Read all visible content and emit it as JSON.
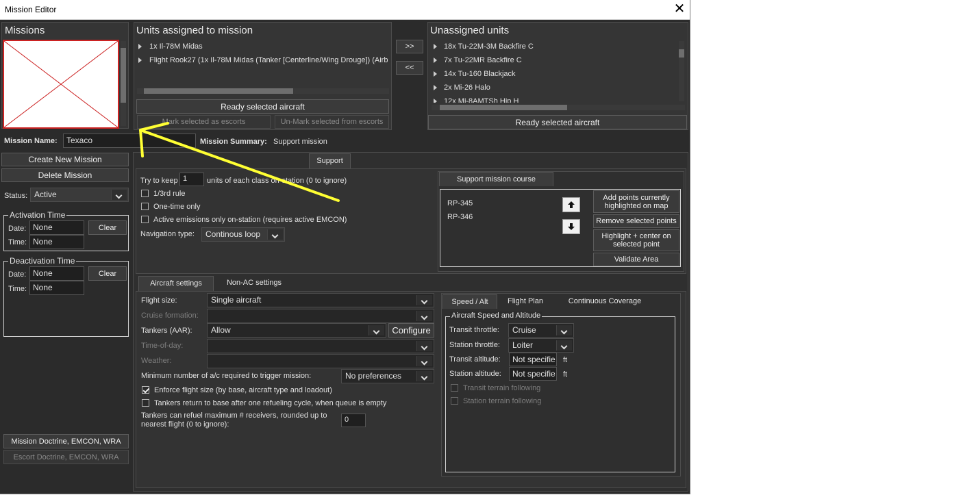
{
  "window": {
    "title": "Mission Editor",
    "close_glyph": "✕"
  },
  "missions": {
    "header": "Missions",
    "name_label": "Mission Name:",
    "name_value": "Texaco",
    "summary_label": "Mission Summary:",
    "summary_value": "Support mission",
    "create_button": "Create New Mission",
    "delete_button": "Delete Mission",
    "status_label": "Status:",
    "status_value": "Active"
  },
  "activation": {
    "title": "Activation Time",
    "date_label": "Date:",
    "date_value": "None",
    "time_label": "Time:",
    "time_value": "None",
    "clear": "Clear"
  },
  "deactivation": {
    "title": "Deactivation Time",
    "date_label": "Date:",
    "date_value": "None",
    "time_label": "Time:",
    "time_value": "None",
    "clear": "Clear"
  },
  "doctrine": {
    "mission_button": "Mission Doctrine, EMCON, WRA",
    "escort_button": "Escort Doctrine, EMCON, WRA"
  },
  "assigned": {
    "header": "Units assigned to mission",
    "items": [
      "1x Il-78M Midas",
      "Flight Rook27 (1x Il-78M Midas (Tanker [Centerline/Wing Drouge]) (Airb"
    ],
    "ready_button": "Ready selected aircraft",
    "mark_button": "Mark selected as escorts",
    "unmark_button": "Un-Mark selected from escorts"
  },
  "transfer": {
    "assign": ">>",
    "unassign": "<<"
  },
  "unassigned": {
    "header": "Unassigned units",
    "items": [
      "18x Tu-22M-3M Backfire C",
      "7x Tu-22MR Backfire C",
      "14x Tu-160 Blackjack",
      "2x Mi-26 Halo",
      "12x Mi-8AMTSh Hip H"
    ],
    "ready_button": "Ready selected aircraft"
  },
  "support": {
    "tab": "Support",
    "keep_prefix": "Try to keep",
    "keep_value": "1",
    "keep_suffix": "units of each class on-station (0 to ignore)",
    "one_third": "1/3rd rule",
    "one_time": "One-time only",
    "emissions": "Active emissions only on-station (requires active EMCON)",
    "nav_label": "Navigation type:",
    "nav_value": "Continous loop"
  },
  "course": {
    "tab": "Support mission course",
    "points": [
      "RP-345",
      "RP-346"
    ],
    "add_button": "Add points currently highlighted on map",
    "remove_button": "Remove selected points",
    "highlight_button": "Highlight + center on selected point",
    "validate_button": "Validate Area"
  },
  "aircraft_tabs": {
    "aircraft": "Aircraft settings",
    "non_ac": "Non-AC settings"
  },
  "aircraft": {
    "flight_size_label": "Flight size:",
    "flight_size_value": "Single aircraft",
    "cruise_label": "Cruise formation:",
    "tankers_label": "Tankers (AAR):",
    "tankers_value": "Allow",
    "configure_button": "Configure",
    "tod_label": "Time-of-day:",
    "weather_label": "Weather:",
    "min_label": "Minimum number of a/c required to trigger mission:",
    "min_value": "No preferences",
    "enforce": "Enforce flight size (by base, aircraft type and loadout)",
    "tankers_return": "Tankers return to base after one refueling cycle, when queue is empty",
    "refuel_label": "Tankers can refuel maximum # receivers, rounded up to nearest flight (0 to ignore):",
    "refuel_value": "0"
  },
  "speed_tabs": {
    "speed": "Speed / Alt",
    "plan": "Flight Plan",
    "coverage": "Continuous Coverage"
  },
  "speed": {
    "group_title": "Aircraft Speed and Altitude",
    "transit_throttle_label": "Transit throttle:",
    "transit_throttle_value": "Cruise",
    "station_throttle_label": "Station throttle:",
    "station_throttle_value": "Loiter",
    "transit_alt_label": "Transit altitude:",
    "transit_alt_value": "Not specifie",
    "station_alt_label": "Station altitude:",
    "station_alt_value": "Not specifie",
    "unit": "ft",
    "transit_terrain": "Transit terrain following",
    "station_terrain": "Station terrain following"
  },
  "colors": {
    "background": "#2b2b2b",
    "panel": "#353535",
    "annotation_arrow": "#ffff33",
    "placeholder_border": "#cc2222"
  }
}
